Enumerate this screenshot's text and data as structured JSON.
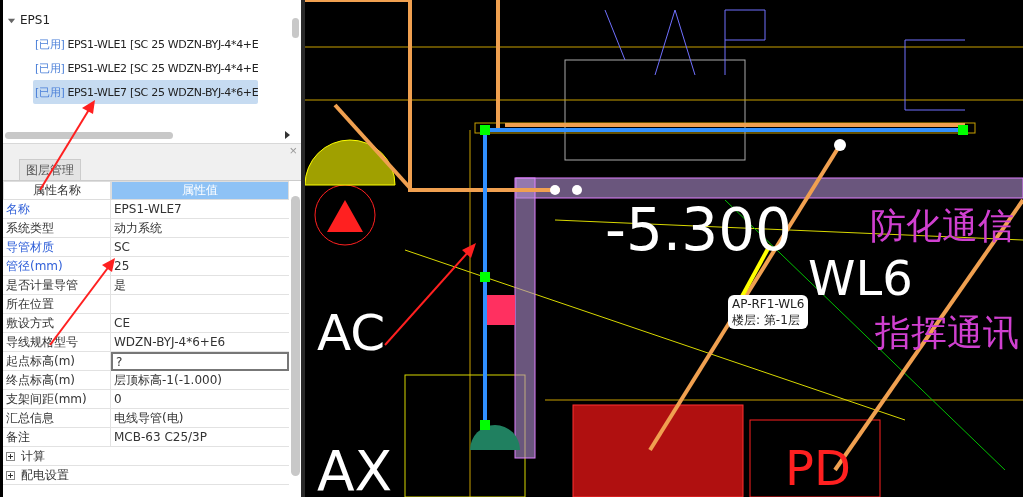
{
  "tree": {
    "groups": [
      {
        "label": "EPS1",
        "expanded": true,
        "children": [
          {
            "tag": "[已用]",
            "label": "EPS1-WLE1 [SC 25 WDZN-BYJ-4*4+E",
            "selected": false
          },
          {
            "tag": "[已用]",
            "label": "EPS1-WLE2 [SC 25 WDZN-BYJ-4*4+E",
            "selected": false
          },
          {
            "tag": "[已用]",
            "label": "EPS1-WLE7 [SC 25 WDZN-BYJ-4*6+E",
            "selected": true
          }
        ]
      }
    ]
  },
  "panel": {
    "close": "×",
    "tabs": [
      {
        "label": "图层管理",
        "selected": false
      }
    ]
  },
  "properties": {
    "columns": [
      {
        "label": "属性名称",
        "selected": false
      },
      {
        "label": "属性值",
        "selected": true
      }
    ],
    "rows": [
      {
        "kind": "field",
        "name": "名称",
        "value": "EPS1-WLE7",
        "linked": true,
        "focused": false
      },
      {
        "kind": "field",
        "name": "系统类型",
        "value": "动力系统",
        "linked": false,
        "focused": false
      },
      {
        "kind": "field",
        "name": "导管材质",
        "value": "SC",
        "linked": true,
        "focused": false
      },
      {
        "kind": "field",
        "name": "管径(mm)",
        "value": "25",
        "linked": true,
        "focused": false
      },
      {
        "kind": "field",
        "name": "是否计量导管",
        "value": "是",
        "linked": false,
        "focused": false
      },
      {
        "kind": "field",
        "name": "所在位置",
        "linked": false,
        "focused": false
      },
      {
        "kind": "field",
        "name": "敷设方式",
        "value": "CE",
        "linked": false,
        "focused": false
      },
      {
        "kind": "field",
        "name": "导线规格型号",
        "value": "WDZN-BYJ-4*6+E6",
        "linked": false,
        "focused": false
      },
      {
        "kind": "field",
        "name": "起点标高(m)",
        "value": "?",
        "linked": false,
        "focused": true
      },
      {
        "kind": "field",
        "name": "终点标高(m)",
        "value": "层顶标高-1(-1.000)",
        "linked": false,
        "focused": false
      },
      {
        "kind": "field",
        "name": "支架间距(mm)",
        "value": "0",
        "linked": false,
        "focused": false
      },
      {
        "kind": "field",
        "name": "汇总信息",
        "value": "电线导管(电)",
        "linked": false,
        "focused": false
      },
      {
        "kind": "field",
        "name": "备注",
        "value": "MCB-63 C25/3P",
        "linked": false,
        "focused": false
      },
      {
        "kind": "group",
        "name": "计算",
        "expanded": false
      },
      {
        "kind": "group",
        "name": "配电设置",
        "expanded": false
      }
    ]
  },
  "canvas": {
    "labels": [
      {
        "kind": "big",
        "text": "-5.300",
        "color": "#ffffff"
      },
      {
        "kind": "wl",
        "text": "WL6",
        "color": "#ffffff"
      },
      {
        "kind": "ac",
        "text": "AC",
        "color": "#ffffff"
      },
      {
        "kind": "ax",
        "text": "AX",
        "color": "#ffffff"
      },
      {
        "kind": "pd",
        "text": "PD",
        "color": "#ff2020"
      },
      {
        "kind": "cn1",
        "text": "防化通信",
        "color": "#d040d0"
      },
      {
        "kind": "cn2",
        "text": "指挥通讯",
        "color": "#d040d0"
      }
    ],
    "tooltip": {
      "title": "AP-RF1-WL6",
      "floor": "楼层: 第-1层"
    }
  }
}
